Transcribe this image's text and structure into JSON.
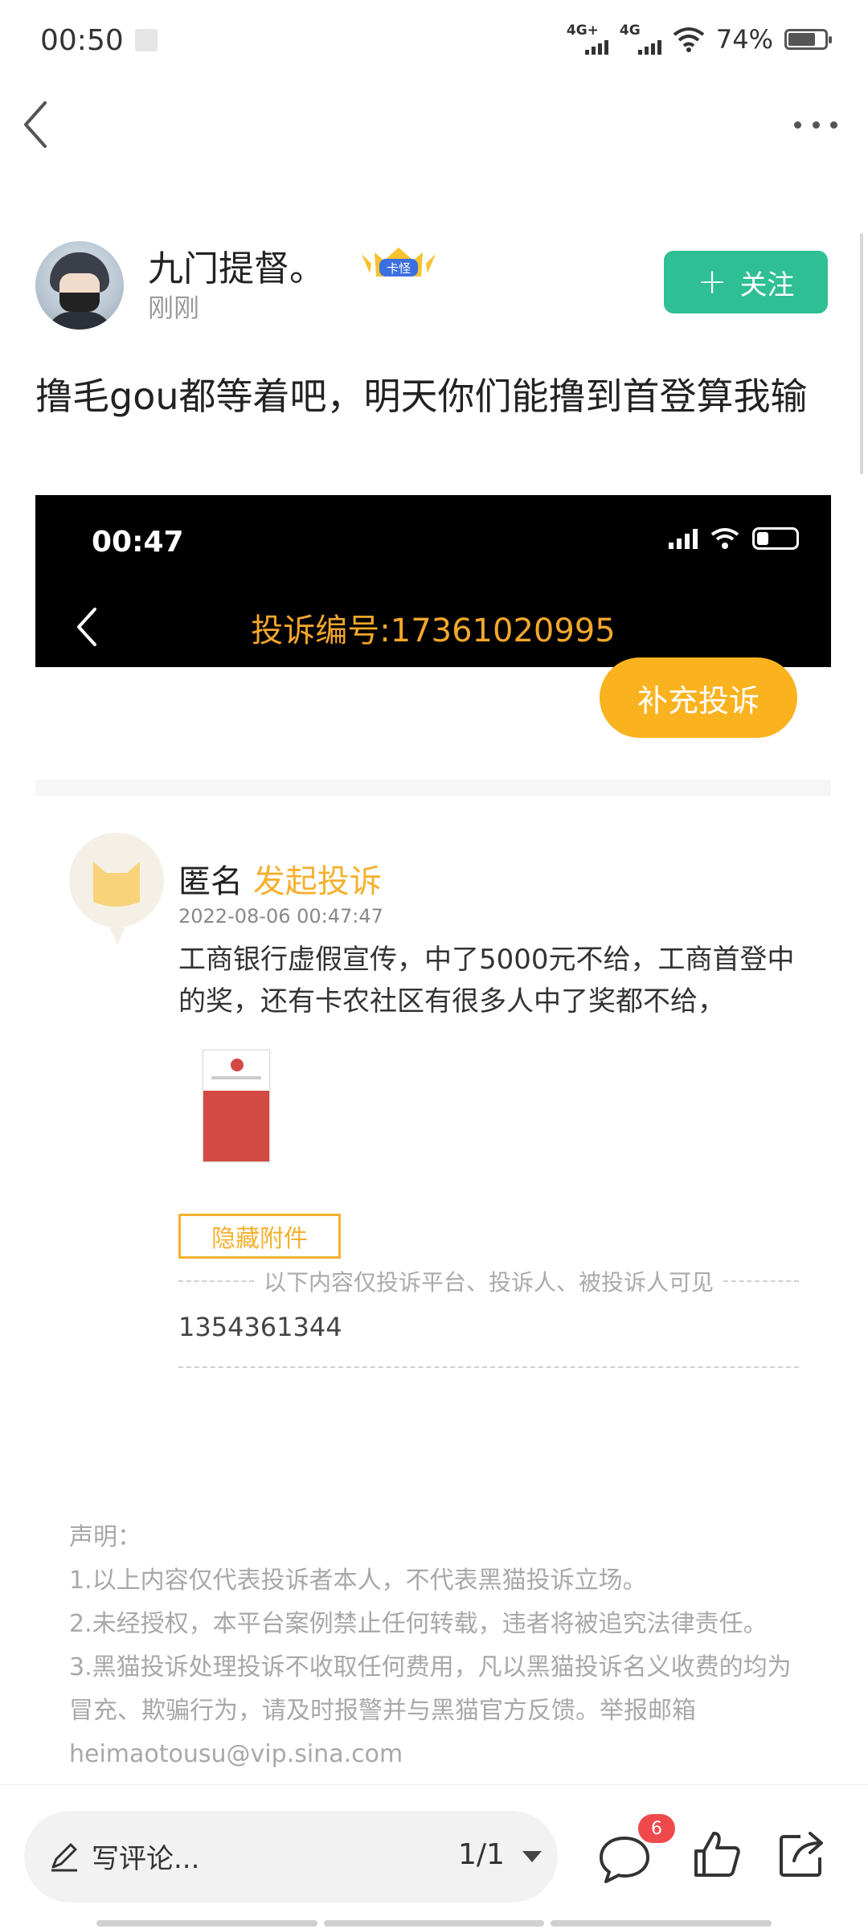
{
  "status_bar": {
    "time": "00:50",
    "network1": "4G+",
    "network2": "4G",
    "battery": "74%",
    "battery_level": 0.74
  },
  "nav": {
    "back_icon": "chevron-left-icon",
    "more_icon": "more-dots-icon"
  },
  "author": {
    "name": "九门提督。",
    "badge": "卡怪",
    "time": "刚刚",
    "follow_label": "关注"
  },
  "post": {
    "text": "撸毛gou都等着吧，明天你们能撸到首登算我输"
  },
  "embedded_screenshot": {
    "time": "00:47",
    "title": "投诉编号:17361020995",
    "title_color": "#f4a72b"
  },
  "supplement_button": "补充投诉",
  "complaint": {
    "anon": "匿名",
    "action": "发起投诉",
    "date": "2022-08-06 00:47:47",
    "text": "工商银行虚假宣传，中了5000元不给，工商首登中的奖，还有卡农社区有很多人中了奖都不给，",
    "hide_attachment": "隐藏附件",
    "private_note": "以下内容仅投诉平台、投诉人、被投诉人可见",
    "private_value": "1354361344"
  },
  "disclaimer": {
    "title": "声明：",
    "line1": "1.以上内容仅代表投诉者本人，不代表黑猫投诉立场。",
    "line2": "2.未经授权，本平台案例禁止任何转载，违者将被追究法律责任。",
    "line3": "3.黑猫投诉处理投诉不收取任何费用，凡以黑猫投诉名义收费的均为冒充、欺骗行为，请及时报警并与黑猫官方反馈。举报邮箱 heimaotousu@vip.sina.com"
  },
  "bottom_bar": {
    "comment_placeholder": "写评论...",
    "page_indicator": "1/1",
    "comment_count": "6",
    "accent": "#2fbf94",
    "warning": "#fbb21f"
  }
}
